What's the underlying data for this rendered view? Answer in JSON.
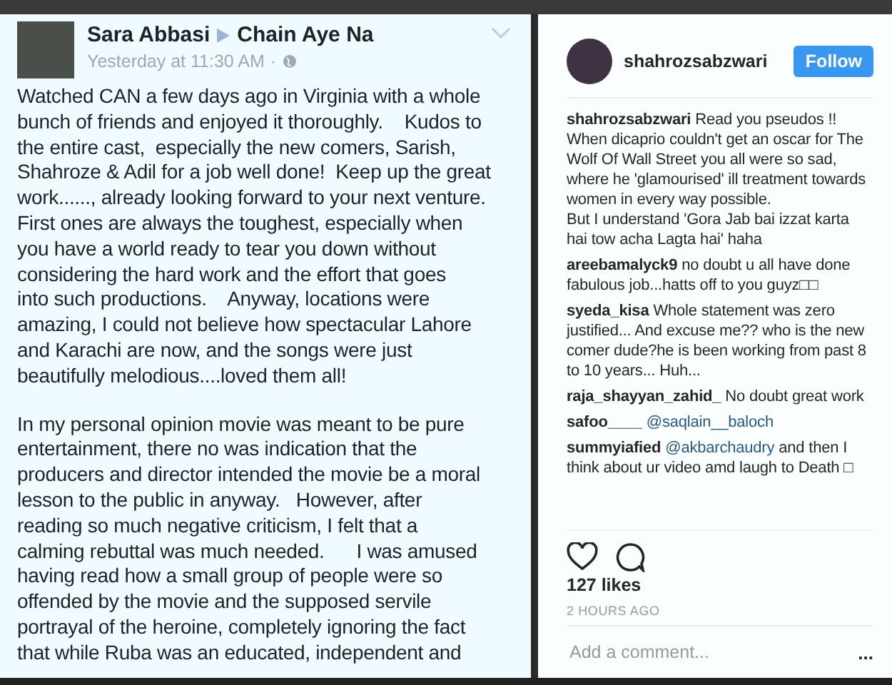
{
  "facebook_post": {
    "author": "Sara Abbasi",
    "target": "Chain Aye Na",
    "time": "Yesterday at 11:30 AM",
    "separator": "·",
    "paragraphs": [
      {
        "lines": [
          "Watched CAN a few days ago in Virginia with a whole",
          "bunch of friends and enjoyed it thoroughly.    Kudos to",
          "the entire cast,  especially the new comers, Sarish,",
          "Shahroze & Adil for a job well done!  Keep up the great",
          "work......, already looking forward to your next venture.",
          "First ones are always the toughest, especially when",
          "you have a world ready to tear you down without",
          "considering the hard work and the effort that goes",
          "into such productions.    Anyway, locations were",
          "amazing, I could not believe how spectacular Lahore",
          "and Karachi are now, and the songs were just",
          "beautifully melodious....loved them all!"
        ]
      },
      {
        "lines": [
          "In my personal opinion movie was meant to be pure",
          "entertainment, there no was indication that the",
          "producers and director intended the movie be a moral",
          "lesson to the public in anyway.   However, after",
          "reading so much negative criticism, I felt that a",
          "calming rebuttal was much needed.      I was amused",
          "having read how a small group of people were so",
          "offended by the movie and the supposed servile",
          "portrayal of the heroine, completely ignoring the fact",
          "that while Ruba was an educated, independent and"
        ]
      }
    ]
  },
  "instagram_post": {
    "username": "shahrozsabzwari",
    "follow_button": "Follow",
    "comments": [
      {
        "username": "shahrozsabzwari",
        "text": "Read you pseudos !! When dicaprio couldn't get an oscar for The Wolf Of Wall Street you all were so sad, where he 'glamourised' ill treatment towards women in every way possible.\nBut I understand 'Gora Jab bai izzat karta hai tow acha Lagta hai' haha"
      },
      {
        "username": "areebamalyck9",
        "text": "no doubt u all have done fabulous job...hatts off to you guyz□□"
      },
      {
        "username": "syeda_kisa",
        "text": "Whole statement was zero justified... And excuse me?? who is the new comer dude?he is been working from past 8 to 10 years... Huh..."
      },
      {
        "username": "raja_shayyan_zahid_",
        "text": "No doubt great work"
      },
      {
        "username": "safoo____",
        "mention": "@saqlain__baloch"
      },
      {
        "username": "summyiafied",
        "mention": "@akbarchaudry",
        "text": "and then I think about ur video amd laugh to Death □"
      }
    ],
    "liked": false,
    "likes": "127 likes",
    "time": "2 HOURS AGO",
    "comment_placeholder": "Add a comment...",
    "more_button": "..."
  }
}
